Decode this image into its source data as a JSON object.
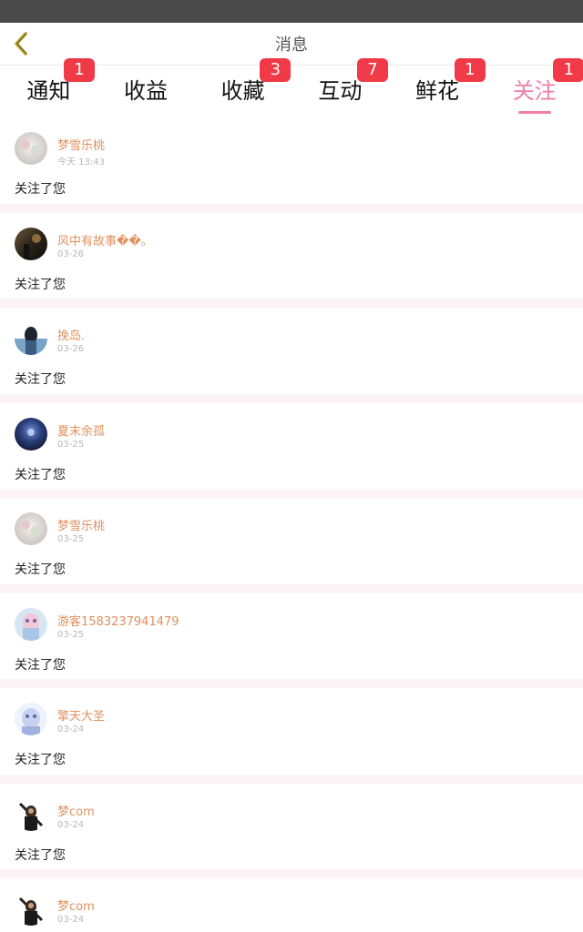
{
  "header": {
    "title": "消息",
    "back_icon": "chevron-left-icon",
    "back_color": "#b5a12c"
  },
  "tabs": [
    {
      "label": "通知",
      "badge": "1",
      "active": false
    },
    {
      "label": "收益",
      "badge": "",
      "active": false
    },
    {
      "label": "收藏",
      "badge": "3",
      "active": false
    },
    {
      "label": "互动",
      "badge": "7",
      "active": false
    },
    {
      "label": "鲜花",
      "badge": "1",
      "active": false
    },
    {
      "label": "关注",
      "badge": "1",
      "active": true
    }
  ],
  "colors": {
    "accent": "#ee7ea7",
    "badge": "#f03a47",
    "name": "#e0915f",
    "separator": "#fbf3f5"
  },
  "items": [
    {
      "name": "梦雪乐桃",
      "time": "今天 13:43",
      "message": "关注了您",
      "avatar": "avatar-pastel"
    },
    {
      "name": "风中有故事��。",
      "time": "03-26",
      "message": "关注了您",
      "avatar": "avatar-dark-sunset"
    },
    {
      "name": "挽岛.",
      "time": "03-26",
      "message": "关注了您",
      "avatar": "avatar-girl-bluebg"
    },
    {
      "name": "夏末余孤",
      "time": "03-25",
      "message": "关注了您",
      "avatar": "avatar-night-blue"
    },
    {
      "name": "梦雪乐桃",
      "time": "03-25",
      "message": "关注了您",
      "avatar": "avatar-pastel"
    },
    {
      "name": "游客1583237941479",
      "time": "03-25",
      "message": "关注了您",
      "avatar": "avatar-anime-pink"
    },
    {
      "name": "擎天大圣",
      "time": "03-24",
      "message": "关注了您",
      "avatar": "avatar-anime-light"
    },
    {
      "name": "梦com",
      "time": "03-24",
      "message": "关注了您",
      "avatar": "avatar-dark-warrior"
    },
    {
      "name": "梦com",
      "time": "03-24",
      "message": "",
      "avatar": "avatar-dark-warrior"
    }
  ]
}
